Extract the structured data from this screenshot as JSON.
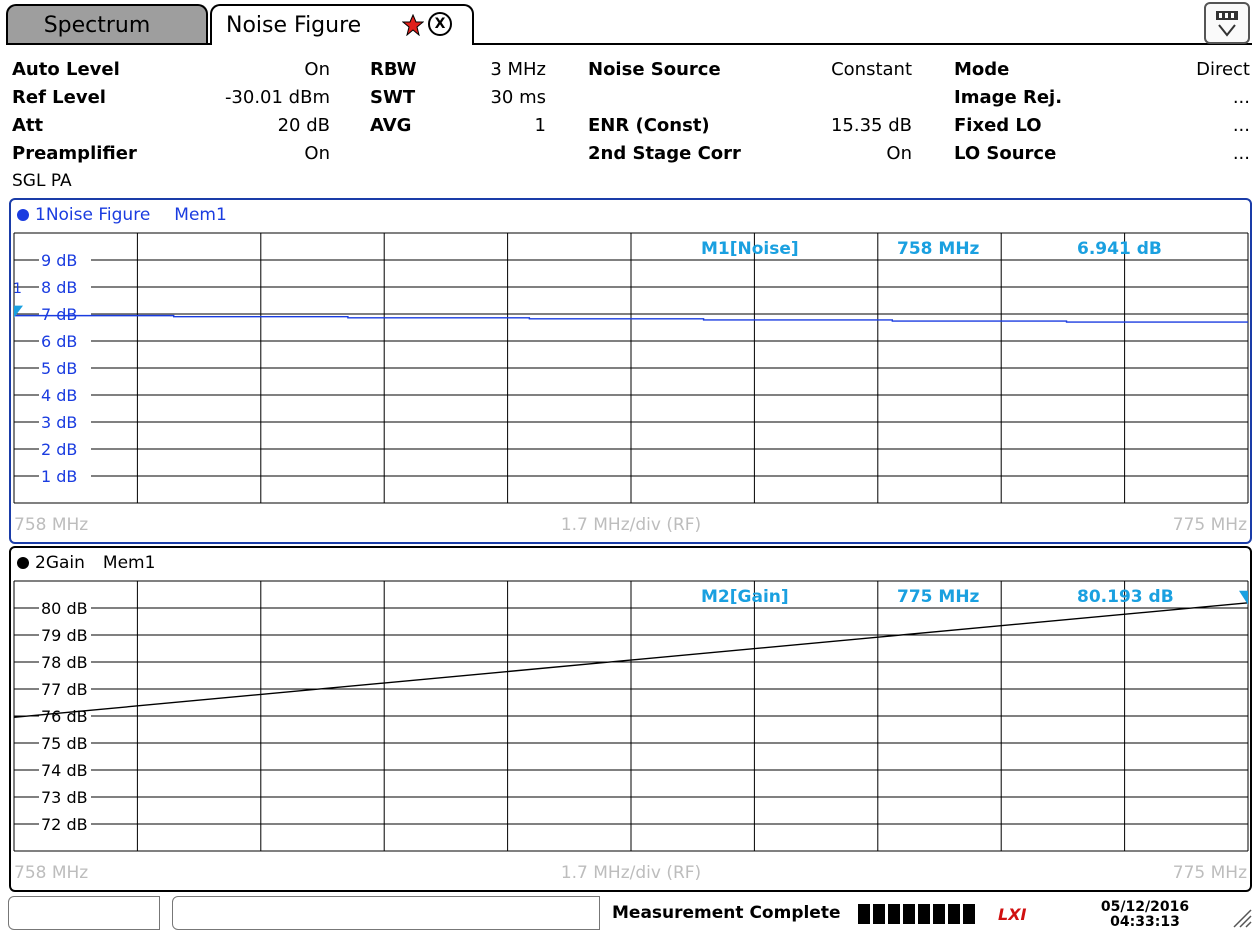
{
  "tabs": [
    {
      "label": "Spectrum",
      "active": false
    },
    {
      "label": "Noise Figure",
      "active": true
    }
  ],
  "settings": {
    "auto_level": {
      "label": "Auto Level",
      "value": "On"
    },
    "ref_level": {
      "label": "Ref Level",
      "value": "-30.01 dBm"
    },
    "att": {
      "label": "Att",
      "value": "20 dB"
    },
    "preamp": {
      "label": "Preamplifier",
      "value": "On"
    },
    "rbw": {
      "label": "RBW",
      "value": "3 MHz"
    },
    "swt": {
      "label": "SWT",
      "value": "30 ms"
    },
    "avg": {
      "label": "AVG",
      "value": "1"
    },
    "noise_source": {
      "label": "Noise Source",
      "value": "Constant"
    },
    "enr": {
      "label": "ENR (Const)",
      "value": "15.35 dB"
    },
    "stage2": {
      "label": "2nd Stage Corr",
      "value": "On"
    },
    "mode": {
      "label": "Mode",
      "value": "Direct"
    },
    "image_rej": {
      "label": "Image Rej.",
      "value": "..."
    },
    "fixed_lo": {
      "label": "Fixed LO",
      "value": "..."
    },
    "lo_source": {
      "label": "LO Source",
      "value": "..."
    },
    "sgl_pa": "SGL  PA"
  },
  "colors": {
    "trace1": "#1a3ce0",
    "trace2": "#000000",
    "marker": "#1aa0e0",
    "axis_dim": "#bdbdbd",
    "panel1_border": "#1a3ca8"
  },
  "chart_data": [
    {
      "type": "line",
      "title": "1Noise Figure",
      "mem": "Mem1",
      "xlabel": "1.7 MHz/div (RF)",
      "x_start": "758 MHz",
      "x_stop": "775 MHz",
      "xlim": [
        758,
        775
      ],
      "ylim": [
        0,
        10
      ],
      "y_ticks": [
        9,
        8,
        7,
        6,
        5,
        4,
        3,
        2,
        1
      ],
      "y_tick_labels": [
        "9 dB",
        "8 dB",
        "7 dB",
        "6 dB",
        "5 dB",
        "4 dB",
        "3 dB",
        "2 dB",
        "1 dB"
      ],
      "series": [
        {
          "x": [
            758,
            760.2,
            760.2,
            762.6,
            762.6,
            765.1,
            765.1,
            767.5,
            767.5,
            770.1,
            770.1,
            772.5,
            772.5,
            775
          ],
          "y": [
            6.94,
            6.94,
            6.9,
            6.9,
            6.86,
            6.86,
            6.82,
            6.82,
            6.78,
            6.78,
            6.74,
            6.74,
            6.7,
            6.7
          ]
        }
      ],
      "marker": {
        "label": "M1[Noise]",
        "freq": "758 MHz",
        "value": "6.941 dB",
        "x": 758,
        "y": 6.941
      },
      "ref_label": "1"
    },
    {
      "type": "line",
      "title": "2Gain",
      "mem": "Mem1",
      "xlabel": "1.7 MHz/div (RF)",
      "x_start": "758 MHz",
      "x_stop": "775 MHz",
      "xlim": [
        758,
        775
      ],
      "ylim": [
        71,
        81
      ],
      "y_ticks": [
        80,
        79,
        78,
        77,
        76,
        75,
        74,
        73,
        72
      ],
      "y_tick_labels": [
        "80 dB",
        "79 dB",
        "78 dB",
        "77 dB",
        "76 dB",
        "75 dB",
        "74 dB",
        "73 dB",
        "72 dB"
      ],
      "series": [
        {
          "x": [
            758,
            775
          ],
          "y": [
            75.95,
            80.193
          ]
        }
      ],
      "marker": {
        "label": "M2[Gain]",
        "freq": "775 MHz",
        "value": "80.193 dB",
        "x": 775,
        "y": 80.193
      }
    }
  ],
  "status": {
    "message": "Measurement Complete",
    "progress_segments": 8,
    "logo": "LXI",
    "date": "05/12/2016",
    "time": "04:33:13 PM"
  }
}
